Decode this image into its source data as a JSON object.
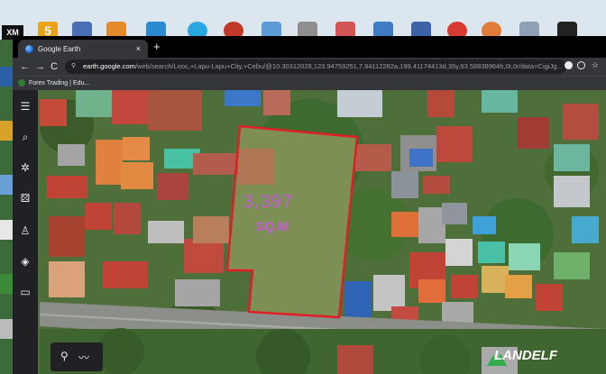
{
  "desktop": {
    "taskbar_label": "XM",
    "badge_number": "5"
  },
  "browser": {
    "tab_title": "Google Earth",
    "tab_close": "×",
    "new_tab": "+",
    "nav": {
      "back": "←",
      "forward": "→",
      "reload": "C"
    },
    "url_host": "earth.google.com",
    "url_path": "/web/search/Looc,+Lapu-Lapu+City,+Cebu/@10.30312028,123.94759251,7.94112282a,199.41174413d,35y,93.58838964h,0t,0r/data=CigiJg...",
    "bookmark": "Forex Trading | Edu..."
  },
  "earth": {
    "sidebar_icons": [
      "menu-icon",
      "search-icon",
      "projects-icon",
      "dice-icon",
      "pegman-icon",
      "layers-icon",
      "ruler-icon"
    ],
    "bottom_icons": [
      "location-pin-icon",
      "measure-path-icon"
    ]
  },
  "annotation": {
    "area_value": "3,397",
    "unit_label": "SQ.M"
  },
  "watermark": "LANDELF",
  "colors": {
    "boundary": "#e01e26",
    "annotation": "#c65cd8",
    "chrome_dark": "#202124"
  }
}
